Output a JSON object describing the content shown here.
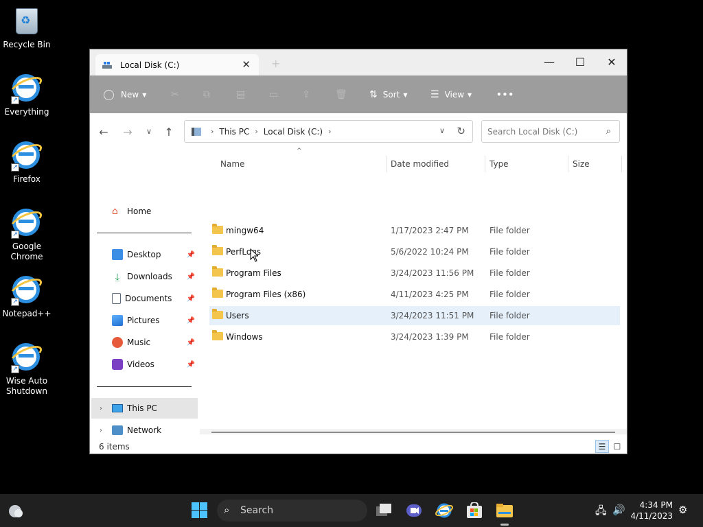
{
  "desktop_icons": [
    {
      "label": "Recycle Bin",
      "icon": "recycle-bin-icon"
    },
    {
      "label": "Everything",
      "icon": "internet-explorer-icon"
    },
    {
      "label": "Firefox",
      "icon": "internet-explorer-icon"
    },
    {
      "label": "Google Chrome",
      "icon": "internet-explorer-icon"
    },
    {
      "label": "Notepad++",
      "icon": "internet-explorer-icon"
    },
    {
      "label": "Wise Auto Shutdown",
      "icon": "internet-explorer-icon"
    }
  ],
  "window": {
    "tab_title": "Local Disk (C:)",
    "new_tab": "+",
    "controls": {
      "minimize": "—",
      "maximize": "☐",
      "close": "✕"
    }
  },
  "toolbar": {
    "new_label": "New",
    "sort_label": "Sort",
    "view_label": "View",
    "more": "•••",
    "cut": "✂",
    "copy": "⧉",
    "paste": "▤",
    "rename": "▭",
    "share": "⇪",
    "delete": "🗑"
  },
  "address": {
    "segments": [
      "This PC",
      "Local Disk (C:)"
    ],
    "search_placeholder": "Search Local Disk (C:)"
  },
  "nav": {
    "home": "Home",
    "quick_access": [
      {
        "label": "Desktop",
        "icon": "desktop-icon",
        "color": "#3a8ee6"
      },
      {
        "label": "Downloads",
        "icon": "download-icon",
        "color": "#2a9d5a"
      },
      {
        "label": "Documents",
        "icon": "documents-icon",
        "color": "#5b6b7c"
      },
      {
        "label": "Pictures",
        "icon": "pictures-icon",
        "color": "#1e88e5"
      },
      {
        "label": "Music",
        "icon": "music-icon",
        "color": "#e65a3a"
      },
      {
        "label": "Videos",
        "icon": "videos-icon",
        "color": "#7b3fc4"
      }
    ],
    "this_pc": "This PC",
    "network": "Network"
  },
  "columns": {
    "name": "Name",
    "date": "Date modified",
    "type": "Type",
    "size": "Size"
  },
  "files": [
    {
      "name": "mingw64",
      "date": "1/17/2023 2:47 PM",
      "type": "File folder"
    },
    {
      "name": "PerfLogs",
      "date": "5/6/2022 10:24 PM",
      "type": "File folder"
    },
    {
      "name": "Program Files",
      "date": "3/24/2023 11:56 PM",
      "type": "File folder"
    },
    {
      "name": "Program Files (x86)",
      "date": "4/11/2023 4:25 PM",
      "type": "File folder"
    },
    {
      "name": "Users",
      "date": "3/24/2023 11:51 PM",
      "type": "File folder"
    },
    {
      "name": "Windows",
      "date": "3/24/2023 1:39 PM",
      "type": "File folder"
    }
  ],
  "status": {
    "count": "6 items"
  },
  "taskbar": {
    "search_label": "Search",
    "time": "4:34 PM",
    "date": "4/11/2023"
  }
}
